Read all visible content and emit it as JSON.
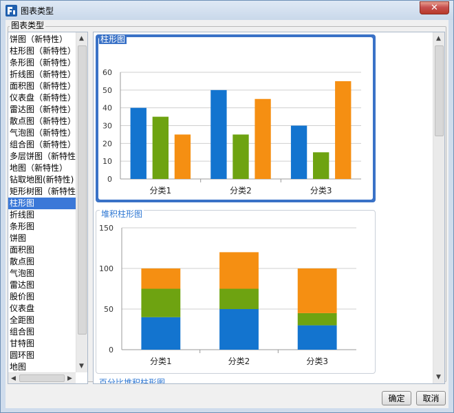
{
  "window": {
    "title": "图表类型",
    "close_label": "✕"
  },
  "group": {
    "label": "图表类型"
  },
  "list": {
    "selected_index": 14,
    "items": [
      "饼图（新特性）",
      "柱形图（新特性）",
      "条形图（新特性）",
      "折线图（新特性）",
      "面积图（新特性）",
      "仪表盘（新特性）",
      "雷达图（新特性）",
      "散点图（新特性）",
      "气泡图（新特性）",
      "组合图（新特性）",
      "多层饼图（新特性）",
      "地图（新特性）",
      "钻取地图(新特性)",
      "矩形树图（新特性）",
      "柱形图",
      "折线图",
      "条形图",
      "饼图",
      "面积图",
      "散点图",
      "气泡图",
      "雷达图",
      "股价图",
      "仪表盘",
      "全距图",
      "组合图",
      "甘特图",
      "圆环图",
      "地图"
    ]
  },
  "preview": {
    "cards": [
      {
        "title": "柱形图",
        "selected": true
      },
      {
        "title": "堆积柱形图",
        "selected": false
      },
      {
        "title": "百分比堆积柱形图",
        "selected": false
      }
    ]
  },
  "colors": {
    "blue": "#1374cf",
    "green": "#6ea311",
    "orange": "#f58f12",
    "accent": "#3a72c7"
  },
  "chart_data": [
    {
      "type": "bar",
      "title": "柱形图",
      "categories": [
        "分类1",
        "分类2",
        "分类3"
      ],
      "series": [
        {
          "values": [
            40,
            50,
            30
          ]
        },
        {
          "values": [
            35,
            25,
            15
          ]
        },
        {
          "values": [
            25,
            45,
            55
          ]
        }
      ],
      "ylim": [
        0,
        60
      ],
      "yticks": [
        "0",
        "10",
        "20",
        "30",
        "40",
        "50",
        "60"
      ],
      "grid": true
    },
    {
      "type": "bar",
      "stacked": true,
      "title": "堆积柱形图",
      "categories": [
        "分类1",
        "分类2",
        "分类3"
      ],
      "series": [
        {
          "values": [
            40,
            50,
            30
          ]
        },
        {
          "values": [
            35,
            25,
            15
          ]
        },
        {
          "values": [
            25,
            45,
            55
          ]
        }
      ],
      "ylim": [
        0,
        150
      ],
      "yticks": [
        "0",
        "50",
        "100",
        "150"
      ],
      "grid": true
    }
  ],
  "buttons": {
    "ok": "确定",
    "cancel": "取消"
  }
}
